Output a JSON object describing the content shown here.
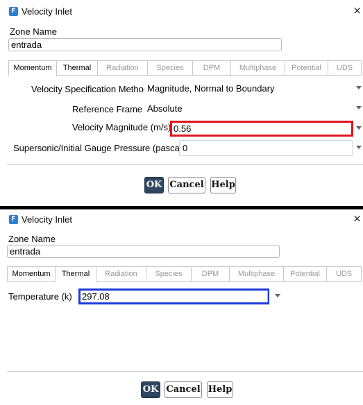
{
  "momentum_dialog": {
    "title": "Velocity Inlet",
    "app_icon": "F",
    "close_glyph": "×",
    "zone_name_label": "Zone Name",
    "zone_name_value": "entrada",
    "tabs": [
      {
        "label": "Momentum",
        "active": true
      },
      {
        "label": "Thermal",
        "active": false
      },
      {
        "label": "Radiation",
        "active": false
      },
      {
        "label": "Species",
        "active": false
      },
      {
        "label": "DPM",
        "active": false
      },
      {
        "label": "Multiphase",
        "active": false
      },
      {
        "label": "Potential",
        "active": false
      },
      {
        "label": "UDS",
        "active": false
      }
    ],
    "rows": {
      "method_label": "Velocity Specification Method",
      "method_value": "Magnitude, Normal to Boundary",
      "frame_label": "Reference Frame",
      "frame_value": "Absolute",
      "magnitude_label": "Velocity Magnitude (m/s)",
      "magnitude_value": "0.56",
      "pressure_label": "Supersonic/Initial Gauge Pressure (pascal)",
      "pressure_value": "0"
    },
    "buttons": {
      "ok": "OK",
      "cancel": "Cancel",
      "help": "Help"
    }
  },
  "thermal_dialog": {
    "title": "Velocity Inlet",
    "app_icon": "F",
    "close_glyph": "×",
    "zone_name_label": "Zone Name",
    "zone_name_value": "entrada",
    "tabs": [
      {
        "label": "Momentum",
        "active": false
      },
      {
        "label": "Thermal",
        "active": true
      },
      {
        "label": "Radiation",
        "active": false
      },
      {
        "label": "Species",
        "active": false
      },
      {
        "label": "DPM",
        "active": false
      },
      {
        "label": "Multiphase",
        "active": false
      },
      {
        "label": "Potential",
        "active": false
      },
      {
        "label": "UDS",
        "active": false
      }
    ],
    "rows": {
      "temperature_label": "Temperature (k)",
      "temperature_value": "297.08"
    },
    "buttons": {
      "ok": "OK",
      "cancel": "Cancel",
      "help": "Help"
    }
  },
  "colors": {
    "highlight_red": "#e0141c",
    "highlight_blue": "#1c39d8",
    "ok_button": "#2f4660",
    "app_icon": "#2b7fd8"
  },
  "icons": [
    "fluent-app-icon",
    "close-icon",
    "dropdown-arrow-icon"
  ]
}
